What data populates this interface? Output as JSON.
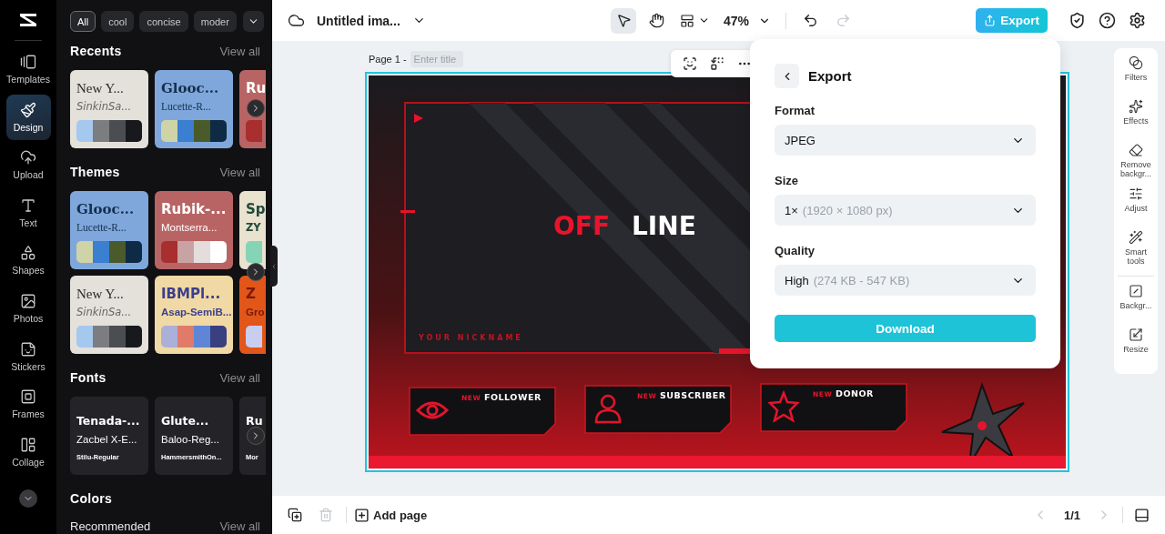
{
  "rail": {
    "items": [
      {
        "label": "Templates",
        "selected": false
      },
      {
        "label": "Design",
        "selected": true
      },
      {
        "label": "Upload",
        "selected": false
      },
      {
        "label": "Text",
        "selected": false
      },
      {
        "label": "Shapes",
        "selected": false
      },
      {
        "label": "Photos",
        "selected": false
      },
      {
        "label": "Stickers",
        "selected": false
      },
      {
        "label": "Frames",
        "selected": false
      },
      {
        "label": "Collage",
        "selected": false
      }
    ]
  },
  "panel": {
    "chips": [
      {
        "label": "All",
        "selected": true
      },
      {
        "label": "cool",
        "selected": false
      },
      {
        "label": "concise",
        "selected": false
      },
      {
        "label": "moder",
        "selected": false
      }
    ],
    "sections": [
      {
        "kind": "themes",
        "title": "Recents",
        "view_all": "View all",
        "rows": [
          [
            {
              "kind": "stone",
              "title": "New Y...",
              "subtitle": "SinkinSa...",
              "swatches": [
                {
                  "color": "#a5c8ef"
                },
                {
                  "color": "#7b7d80"
                },
                {
                  "color": "#4a4d52"
                },
                {
                  "color": "#17191d"
                }
              ]
            },
            {
              "kind": "sky",
              "title": "Glooc...",
              "subtitle": "Lucette-R...",
              "swatches": [
                {
                  "color": "#cfd3a8"
                },
                {
                  "color": "#3a7fd0"
                },
                {
                  "color": "#4a5a2a"
                },
                {
                  "color": "#0e2a45"
                }
              ]
            },
            {
              "kind": "rose",
              "title": "Ru",
              "swatches": [
                {
                  "color": "#a92e2e"
                }
              ]
            }
          ]
        ]
      },
      {
        "kind": "themes",
        "title": "Themes",
        "view_all": "View all",
        "rows": [
          [
            {
              "kind": "sky",
              "title": "Glooc...",
              "subtitle": "Lucette-R...",
              "swatches": [
                {
                  "color": "#cfd3a8"
                },
                {
                  "color": "#3a7fd0"
                },
                {
                  "color": "#4a5a2a"
                },
                {
                  "color": "#0e2a45"
                }
              ]
            },
            {
              "kind": "rose",
              "title": "Rubik-...",
              "subtitle": "Montserra...",
              "swatches": [
                {
                  "color": "#a92e2e"
                },
                {
                  "color": "#c9a3a3"
                },
                {
                  "color": "#e5dcdc"
                },
                {
                  "color": "#ffffff"
                }
              ]
            },
            {
              "kind": "cream",
              "title": "Sp",
              "subtitle": "ZY",
              "swatches": [
                {
                  "color": "#86d4b6"
                }
              ]
            }
          ],
          [
            {
              "kind": "stone",
              "title": "New Y...",
              "subtitle": "SinkinSa...",
              "swatches": [
                {
                  "color": "#a5c8ef"
                },
                {
                  "color": "#7b7d80"
                },
                {
                  "color": "#4a4d52"
                },
                {
                  "color": "#17191d"
                }
              ]
            },
            {
              "kind": "sand",
              "title": "IBMPl...",
              "subtitle": "Asap-SemiB...",
              "swatches": [
                {
                  "color": "#aab0d8"
                },
                {
                  "color": "#e07b6a"
                },
                {
                  "color": "#5f85d6"
                },
                {
                  "color": "#3a3f80"
                }
              ]
            },
            {
              "kind": "flame",
              "title": "Z",
              "subtitle": "Gro",
              "swatches": [
                {
                  "color": "#c9cdf0"
                }
              ]
            }
          ]
        ]
      },
      {
        "kind": "fonts",
        "title": "Fonts",
        "view_all": "View all",
        "cards": [
          {
            "lines": [
              {
                "kind": "display",
                "text": "Tenada-..."
              },
              {
                "kind": "sub",
                "text": "Zacbel X-E..."
              },
              {
                "kind": "small",
                "text": "Stilu-Regular"
              }
            ]
          },
          {
            "lines": [
              {
                "kind": "display",
                "text": "Glute..."
              },
              {
                "kind": "sub",
                "text": "Baloo-Reg..."
              },
              {
                "kind": "small",
                "text": "HammersmithOn..."
              }
            ]
          },
          {
            "lines": [
              {
                "kind": "display",
                "text": "Ru"
              },
              {
                "kind": "small",
                "text": "Mor"
              }
            ]
          }
        ]
      },
      {
        "kind": "colors",
        "title": "Colors",
        "subtitle": "Recommended",
        "view_all": "View all"
      }
    ]
  },
  "topbar": {
    "title": "Untitled ima...",
    "zoom": "47%",
    "tools": [
      {
        "kind": "pointer",
        "selected": true
      },
      {
        "kind": "hand",
        "selected": false
      }
    ],
    "redo_disabled": true,
    "export": "Export"
  },
  "page": {
    "label": "Page 1 -",
    "title_placeholder": "Enter title"
  },
  "design": {
    "headline": [
      {
        "text": "OFF",
        "kind": "accent"
      },
      {
        "text": "LINE",
        "kind": "plain"
      }
    ],
    "nickname": "YOUR NICKNAME",
    "alerts": [
      {
        "kind": "eye",
        "tag": "NEW",
        "label": "FOLLOWER"
      },
      {
        "kind": "person",
        "tag": "NEW",
        "label": "SUBSCRIBER"
      },
      {
        "kind": "star",
        "tag": "NEW",
        "label": "DONOR"
      }
    ]
  },
  "tools": {
    "groups": [
      [
        {
          "label": "Filters"
        },
        {
          "label": "Effects"
        },
        {
          "label": "Remove backgr..."
        },
        {
          "label": "Adjust"
        },
        {
          "label": "Smart tools"
        }
      ],
      [
        {
          "label": "Backgr..."
        },
        {
          "label": "Resize"
        }
      ]
    ]
  },
  "export_panel": {
    "title": "Export",
    "fields": [
      {
        "label": "Format",
        "value": "JPEG"
      },
      {
        "label": "Size",
        "value": "1×",
        "hint": "(1920 × 1080 px)"
      },
      {
        "label": "Quality",
        "value": "High",
        "hint": "(274 KB - 547 KB)"
      }
    ],
    "button": "Download"
  },
  "bottombar": {
    "delete_disabled": true,
    "add_page": "Add page",
    "prev_disabled": true,
    "page_count": "1/1",
    "next_disabled": true
  }
}
